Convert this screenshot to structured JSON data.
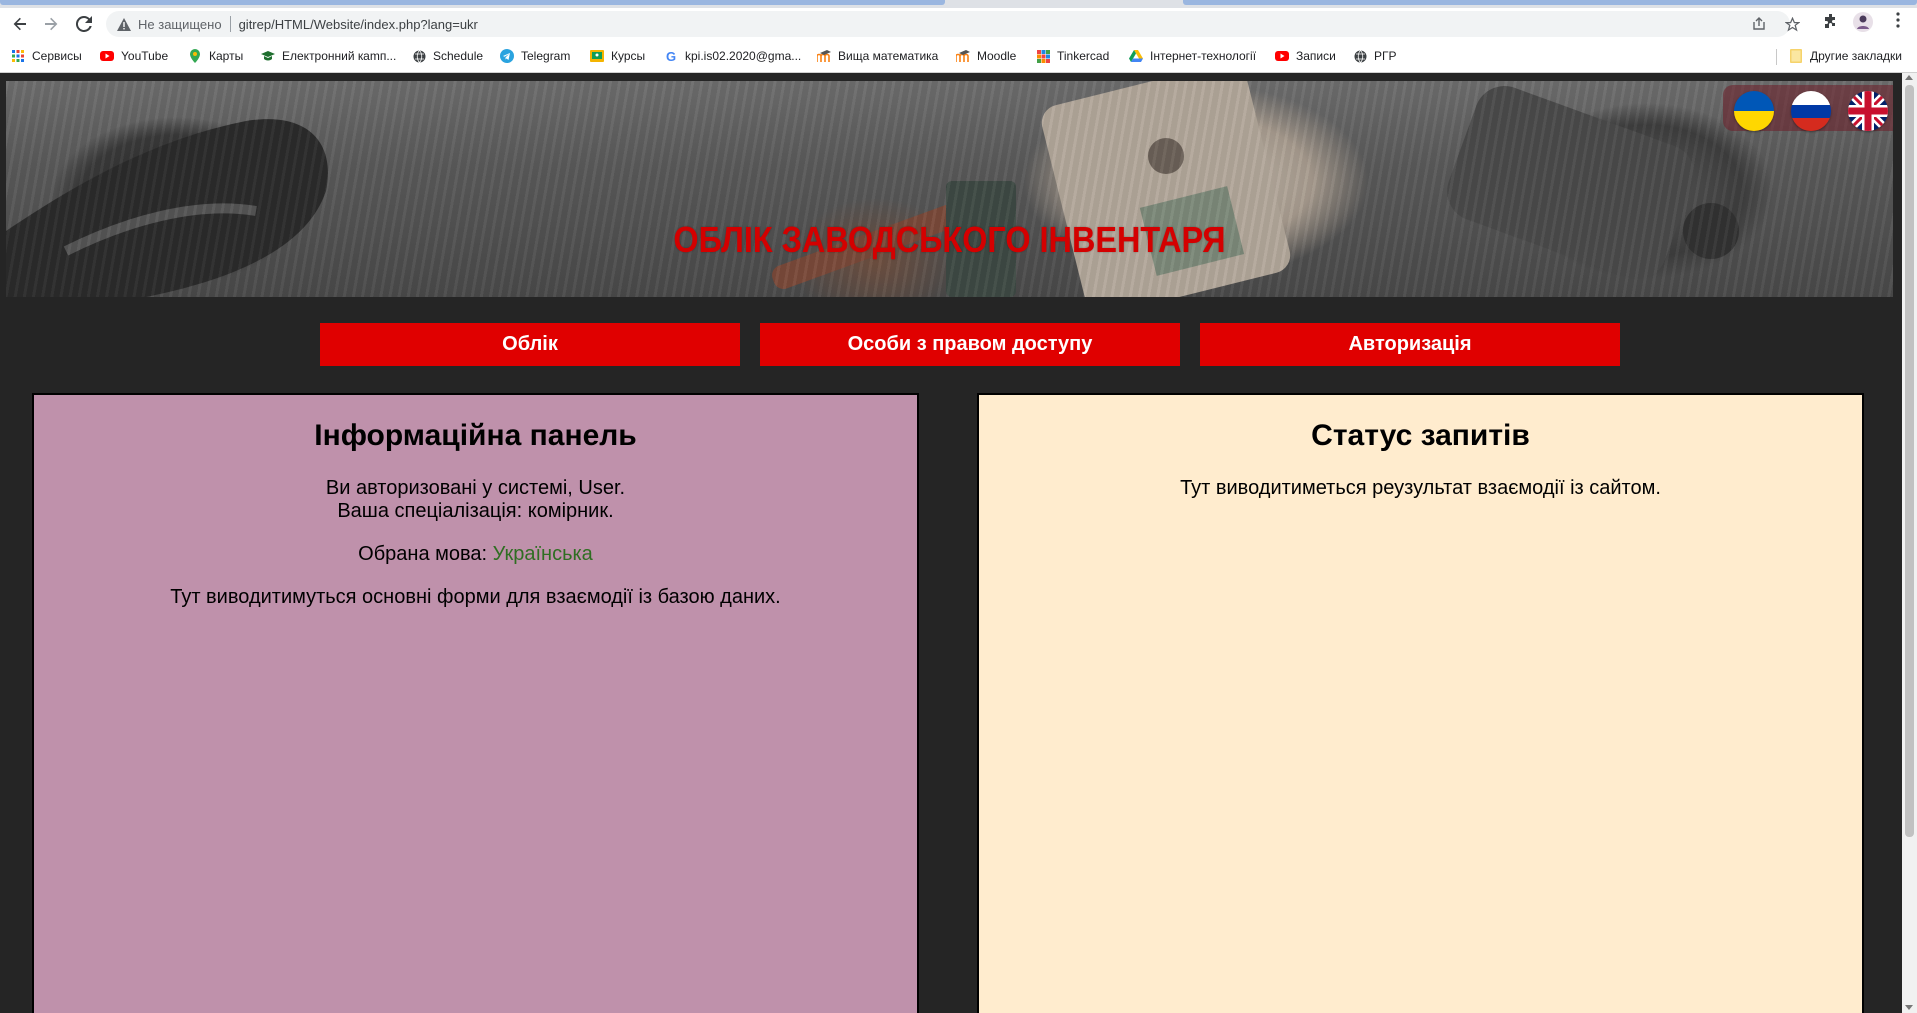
{
  "browser": {
    "url_security_label": "Не защищено",
    "url": "gitrep/HTML/Website/index.php?lang=ukr",
    "bookmarks": [
      {
        "label": "Сервисы",
        "icon": "apps-grid-icon"
      },
      {
        "label": "YouTube",
        "icon": "youtube-icon"
      },
      {
        "label": "Карты",
        "icon": "maps-pin-icon"
      },
      {
        "label": "Електронний кamп...",
        "icon": "graduation-cap-icon"
      },
      {
        "label": "Schedule",
        "icon": "globe-icon"
      },
      {
        "label": "Telegram",
        "icon": "telegram-icon"
      },
      {
        "label": "Курсы",
        "icon": "classroom-icon"
      },
      {
        "label": "kpi.is02.2020@gma...",
        "icon": "google-g-icon"
      },
      {
        "label": "Вища математика",
        "icon": "moodle-icon"
      },
      {
        "label": "Moodle",
        "icon": "moodle-icon"
      },
      {
        "label": "Tinkercad",
        "icon": "tinkercad-icon"
      },
      {
        "label": "Інтернет-технології",
        "icon": "google-drive-icon"
      },
      {
        "label": "Записи",
        "icon": "youtube-icon"
      },
      {
        "label": "РГР",
        "icon": "globe-icon"
      }
    ],
    "other_bookmarks": "Другие закладки"
  },
  "site": {
    "title": "ОБЛІК ЗАВОДСЬКОГО ІНВЕНТАРЯ",
    "languages": [
      "ukrainian-flag-icon",
      "russian-flag-icon",
      "uk-flag-icon"
    ]
  },
  "nav": {
    "items": [
      "Облік",
      "Особи з правом доступу",
      "Авторизація"
    ]
  },
  "info_panel": {
    "title": "Інформаційна панель",
    "auth_line1": "Ви авторизовані у системі, User.",
    "auth_line2": "Ваша спеціалізація: комірник.",
    "language_label": "Обрана мова: ",
    "language_value": "Українська",
    "body": "Тут виводитимуться основні форми для взаємодії із базою даних."
  },
  "status_panel": {
    "title": "Статус запитів",
    "body": "Тут виводитиметься реузультат взаємодії із сайтом."
  },
  "colors": {
    "title_red": "#d40000",
    "nav_red": "#e00000",
    "info_panel_bg": "#bf91ab",
    "status_panel_bg": "#ffecce",
    "page_bg": "#252525",
    "green_text": "#2f6e22"
  }
}
